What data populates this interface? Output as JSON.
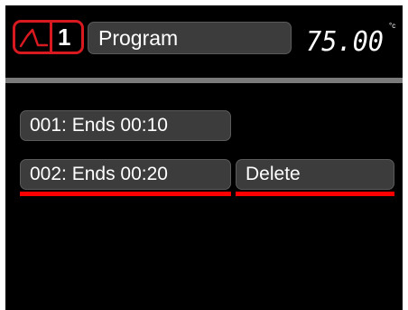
{
  "header": {
    "program_number": "1",
    "title": "Program",
    "temperature": "75.00",
    "temperature_unit": "°c"
  },
  "segments": [
    {
      "label": "001: Ends 00:10",
      "selected": false
    },
    {
      "label": "002: Ends 00:20",
      "selected": true
    }
  ],
  "actions": {
    "delete_label": "Delete"
  },
  "colors": {
    "accent": "#d81920",
    "selection_underline": "#ff0000",
    "button_bg": "#3c3c3c",
    "screen_bg": "#000000",
    "rule": "#7a7a7a"
  },
  "icons": {
    "profile": "ramp-profile-icon"
  }
}
